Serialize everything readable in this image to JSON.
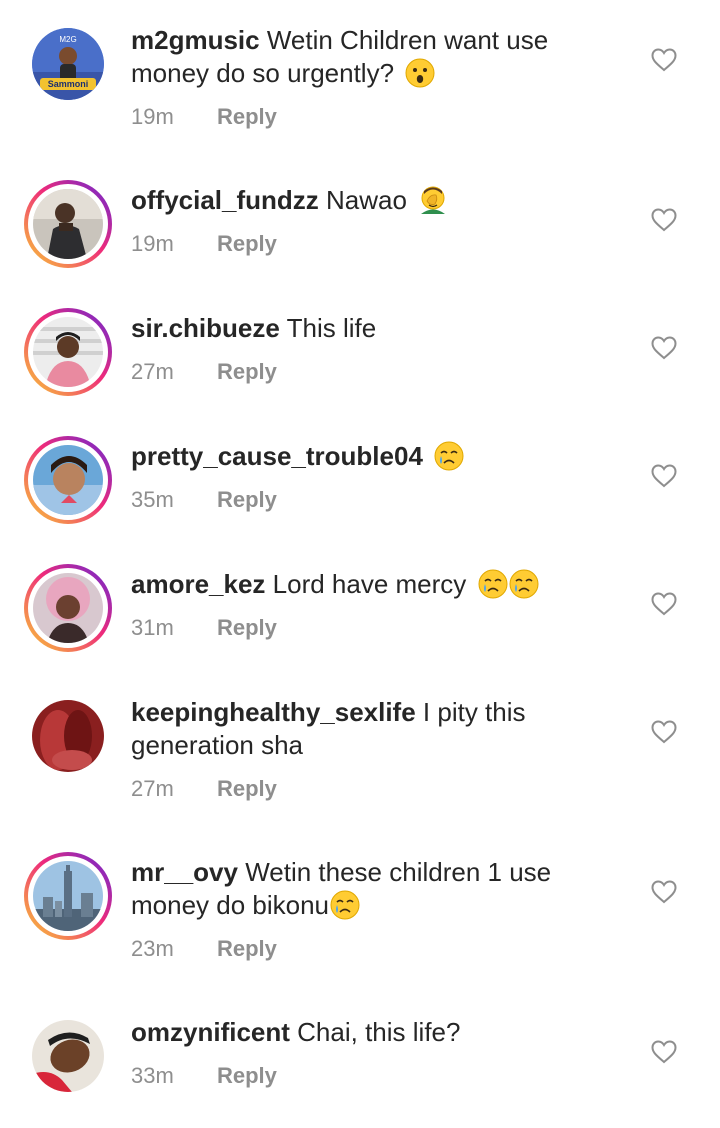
{
  "comments": [
    {
      "username": "m2gmusic",
      "text": "Wetin Children want use money do so urgently?",
      "emoji": [
        "astonished-face-emoji"
      ],
      "time": "19m",
      "reply": "Reply",
      "avatar_text": "M2G Sammoni"
    },
    {
      "username": "offycial_fundzz",
      "text": "Nawao",
      "emoji": [
        "man-facepalming-emoji"
      ],
      "time": "19m",
      "reply": "Reply"
    },
    {
      "username": "sir.chibueze",
      "text": "This life",
      "emoji": [],
      "time": "27m",
      "reply": "Reply"
    },
    {
      "username": "pretty_cause_trouble04",
      "text": "",
      "emoji": [
        "crying-face-emoji"
      ],
      "time": "35m",
      "reply": "Reply"
    },
    {
      "username": "amore_kez",
      "text": "Lord have mercy",
      "emoji": [
        "crying-face-emoji",
        "crying-face-emoji"
      ],
      "time": "31m",
      "reply": "Reply"
    },
    {
      "username": "keepinghealthy_sexlife",
      "text": "I pity this generation sha",
      "emoji": [],
      "time": "27m",
      "reply": "Reply"
    },
    {
      "username": "mr__ovy",
      "text": "Wetin these children 1 use money do bikonu",
      "emoji": [
        "crying-face-emoji"
      ],
      "time": "23m",
      "reply": "Reply"
    },
    {
      "username": "omzynificent",
      "text": "Chai, this life?",
      "emoji": [],
      "time": "33m",
      "reply": "Reply"
    }
  ],
  "colors": {
    "text": "#262626",
    "meta": "#8e8e8e",
    "story_ring_start": "#f9ce34",
    "story_ring_mid": "#ee2a7b",
    "story_ring_end": "#6228d7"
  }
}
